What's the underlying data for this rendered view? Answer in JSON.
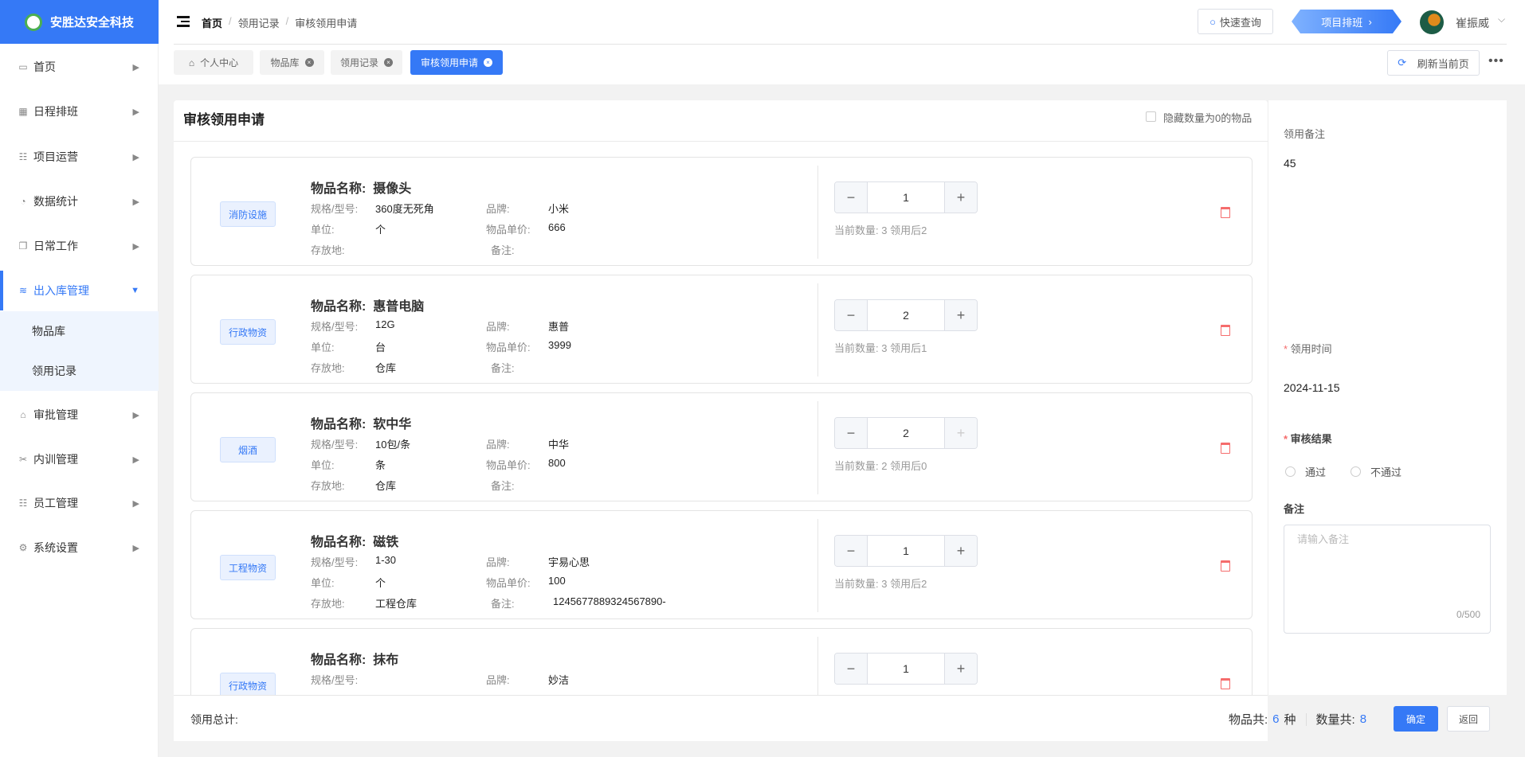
{
  "app": {
    "name": "安胜达安全科技"
  },
  "sidebar": [
    {
      "label": "首页",
      "icon": "monitor-icon",
      "glyph": "▭"
    },
    {
      "label": "日程排班",
      "icon": "calendar-icon",
      "glyph": "▦"
    },
    {
      "label": "项目运营",
      "icon": "list-icon",
      "glyph": "☷"
    },
    {
      "label": "数据统计",
      "icon": "pie-chart-icon",
      "glyph": "◔"
    },
    {
      "label": "日常工作",
      "icon": "copy-icon",
      "glyph": "❐"
    },
    {
      "label": "出入库管理",
      "icon": "layers-icon",
      "glyph": "≋",
      "active": true,
      "children": [
        "物品库",
        "领用记录"
      ]
    },
    {
      "label": "审批管理",
      "icon": "lock-icon",
      "glyph": "⌂"
    },
    {
      "label": "内训管理",
      "icon": "tools-icon",
      "glyph": "✂"
    },
    {
      "label": "员工管理",
      "icon": "list-icon",
      "glyph": "☷"
    },
    {
      "label": "系统设置",
      "icon": "gear-icon",
      "glyph": "⚙"
    }
  ],
  "breadcrumb": [
    "首页",
    "领用记录",
    "审核领用申请"
  ],
  "header": {
    "quick_search": "快速查询",
    "project_schedule": "项目排班",
    "user": "崔振威"
  },
  "tabs": [
    {
      "label": "个人中心"
    },
    {
      "label": "物品库"
    },
    {
      "label": "领用记录"
    },
    {
      "label": "审核领用申请",
      "active": true
    }
  ],
  "refresh_label": "刷新当前页",
  "page": {
    "title": "审核领用申请",
    "hide_zero": "隐藏数量为0的物品"
  },
  "labels": {
    "name": "物品名称:",
    "spec": "规格/型号:",
    "brand": "品牌:",
    "unit": "单位:",
    "price": "物品单价:",
    "location": "存放地:",
    "remark": "备注:"
  },
  "items": [
    {
      "category": "消防设施",
      "name": "摄像头",
      "spec": "360度无死角",
      "brand": "小米",
      "unit": "个",
      "price": "666",
      "location": "",
      "remark": "",
      "qty": "1",
      "stock": "当前数量: 3 领用后2"
    },
    {
      "category": "行政物资",
      "name": "惠普电脑",
      "spec": "12G",
      "brand": "惠普",
      "unit": "台",
      "price": "3999",
      "location": "仓库",
      "remark": "",
      "qty": "2",
      "stock": "当前数量: 3 领用后1"
    },
    {
      "category": "烟酒",
      "name": "软中华",
      "spec": "10包/条",
      "brand": "中华",
      "unit": "条",
      "price": "800",
      "location": "仓库",
      "remark": "",
      "qty": "2",
      "stock": "当前数量: 2 领用后0",
      "plus_disabled": true
    },
    {
      "category": "工程物资",
      "name": "磁铁",
      "spec": "1-30",
      "brand": "宇易心思",
      "unit": "个",
      "price": "100",
      "location": "工程仓库",
      "remark": "1245677889324567890-",
      "qty": "1",
      "stock": "当前数量: 3 领用后2"
    },
    {
      "category": "行政物资",
      "name": "抹布",
      "spec": "",
      "brand": "妙洁",
      "unit": "",
      "price": "",
      "location": "",
      "remark": "",
      "qty": "1",
      "stock": ""
    }
  ],
  "right": {
    "note_label": "领用备注",
    "note_value": "45",
    "time_label": "领用时间",
    "time_value": "2024-11-15",
    "result_label": "审核结果",
    "options": [
      "通过",
      "不通过"
    ],
    "remark_label": "备注",
    "remark_placeholder": "请输入备注",
    "remark_count": "0/500"
  },
  "footer": {
    "total_label": "领用总计:",
    "kinds_label": "物品共:",
    "kinds": "6",
    "kinds_unit": "种",
    "qty_label": "数量共:",
    "qty": "8",
    "confirm": "确定",
    "back": "返回"
  }
}
